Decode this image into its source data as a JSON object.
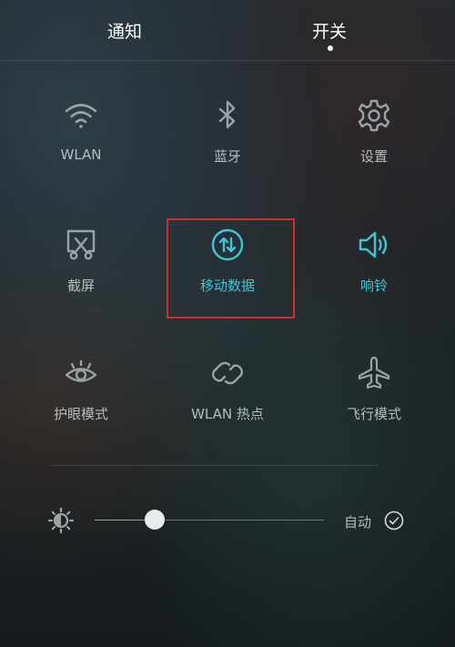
{
  "tabs": {
    "notifications": "通知",
    "toggles": "开关",
    "active": "toggles"
  },
  "colors": {
    "accent": "#3fc6d8",
    "inactive_icon": "#9aa4a7",
    "highlight_border": "#d62b2b",
    "text": "#b4bcbe"
  },
  "tiles": [
    {
      "label": "WLAN",
      "icon": "wifi-icon",
      "active": false
    },
    {
      "label": "蓝牙",
      "icon": "bluetooth-icon",
      "active": false
    },
    {
      "label": "设置",
      "icon": "gear-icon",
      "active": false
    },
    {
      "label": "截屏",
      "icon": "screenshot-icon",
      "active": false
    },
    {
      "label": "移动数据",
      "icon": "mobile-data-icon",
      "active": true
    },
    {
      "label": "响铃",
      "icon": "ringer-icon",
      "active": true
    },
    {
      "label": "护眼模式",
      "icon": "eye-care-icon",
      "active": false
    },
    {
      "label": "WLAN 热点",
      "icon": "hotspot-icon",
      "active": false
    },
    {
      "label": "飞行模式",
      "icon": "airplane-icon",
      "active": false
    }
  ],
  "brightness": {
    "icon": "brightness-icon",
    "level_fraction": 0.26,
    "auto_label": "自动",
    "auto_checked": true,
    "check_icon": "check-icon"
  }
}
